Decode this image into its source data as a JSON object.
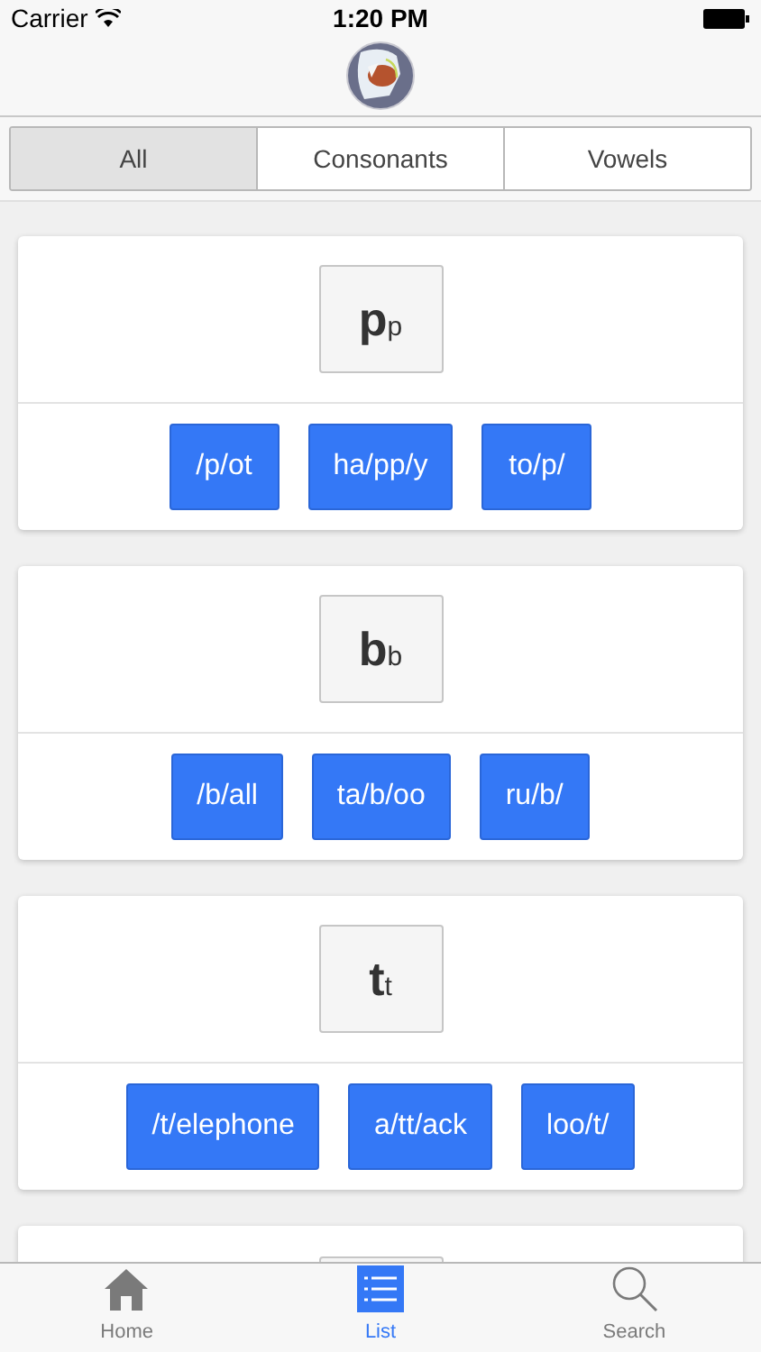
{
  "status_bar": {
    "carrier": "Carrier",
    "time": "1:20 PM"
  },
  "segments": [
    {
      "label": "All",
      "selected": true
    },
    {
      "label": "Consonants",
      "selected": false
    },
    {
      "label": "Vowels",
      "selected": false
    }
  ],
  "cards": [
    {
      "letter": "p",
      "small": "p",
      "examples": [
        "/p/ot",
        "ha/pp/y",
        "to/p/"
      ]
    },
    {
      "letter": "b",
      "small": "b",
      "examples": [
        "/b/all",
        "ta/b/oo",
        "ru/b/"
      ]
    },
    {
      "letter": "t",
      "small": "t",
      "examples": [
        "/t/elephone",
        "a/tt/ack",
        "loo/t/"
      ]
    }
  ],
  "tab_bar": [
    {
      "kind": "home",
      "label": "Home",
      "selected": false
    },
    {
      "kind": "list",
      "label": "List",
      "selected": true
    },
    {
      "kind": "search",
      "label": "Search",
      "selected": false
    }
  ]
}
